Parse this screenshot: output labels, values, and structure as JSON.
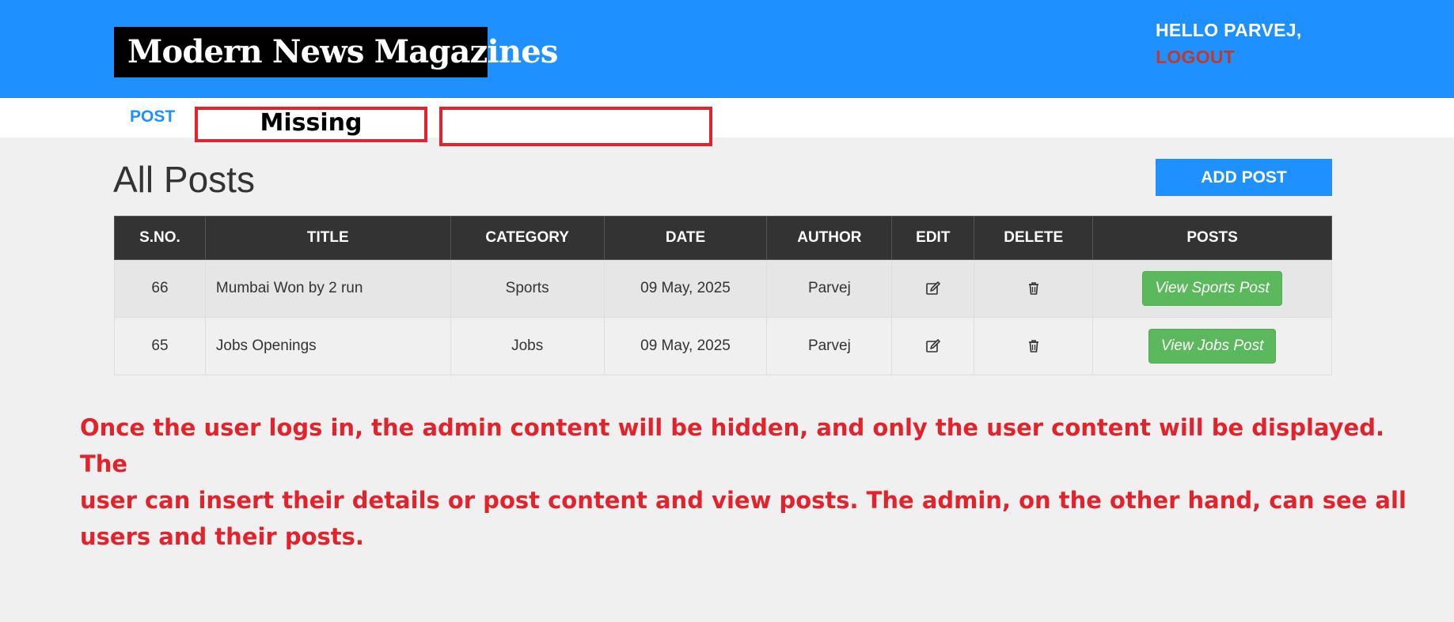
{
  "header": {
    "logo": "Modern News Magazines",
    "greeting": "HELLO PARVEJ,",
    "logout_label": "LOGOUT"
  },
  "menu": {
    "post_label": "POST",
    "missing_label": "Missing"
  },
  "main": {
    "title": "All Posts",
    "add_post_label": "ADD POST"
  },
  "table": {
    "headers": [
      "S.NO.",
      "TITLE",
      "CATEGORY",
      "DATE",
      "AUTHOR",
      "EDIT",
      "DELETE",
      "POSTS"
    ],
    "rows": [
      {
        "sno": "66",
        "title": "Mumbai Won by 2 run",
        "category": "Sports",
        "date": "09 May, 2025",
        "author": "Parvej",
        "view_label": "View Sports Post"
      },
      {
        "sno": "65",
        "title": "Jobs Openings",
        "category": "Jobs",
        "date": "09 May, 2025",
        "author": "Parvej",
        "view_label": "View Jobs Post"
      }
    ]
  },
  "note": {
    "line1": "Once the user logs in, the admin content will be hidden, and only the user content will be displayed. The",
    "line2": "user can insert their details or post content and view posts. The admin, on the other hand, can see all",
    "line3": "users and their posts."
  },
  "colors": {
    "header_bg": "#1e90ff",
    "logout": "#c0392b",
    "table_header_bg": "#333333",
    "view_button": "#5cb85c",
    "annotation_red": "#e3232c"
  },
  "icons": {
    "edit": "edit-icon",
    "delete": "trash-icon"
  }
}
